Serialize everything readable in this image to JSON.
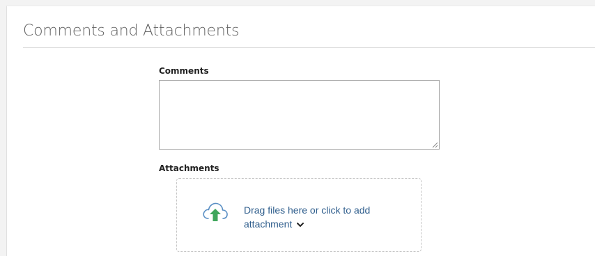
{
  "section": {
    "title": "Comments and Attachments"
  },
  "comments": {
    "label": "Comments",
    "value": ""
  },
  "attachments": {
    "label": "Attachments",
    "dropzone_line1": "Drag files here or click to add",
    "dropzone_line2": "attachment",
    "icons": {
      "upload": "cloud-upload-icon",
      "expand": "chevron-down-icon"
    }
  },
  "colors": {
    "accent_green": "#3fa65c",
    "link_blue": "#2e5d8c",
    "cloud_outline": "#5a8fc4"
  }
}
